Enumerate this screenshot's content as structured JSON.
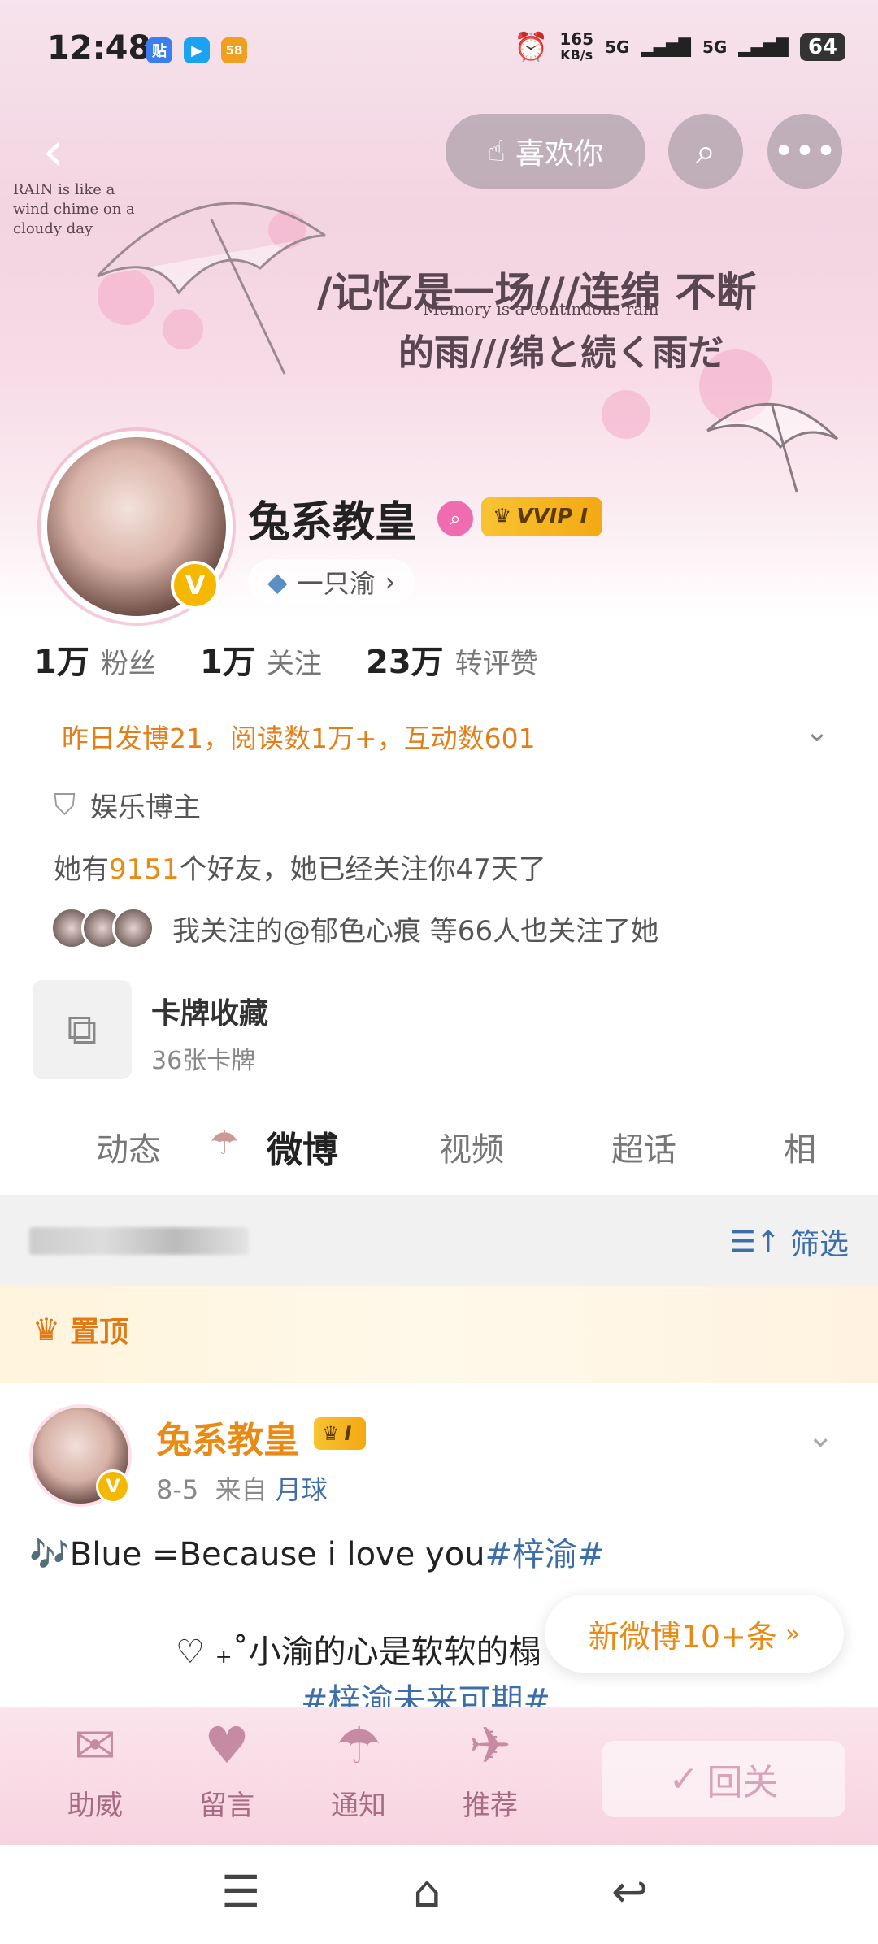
{
  "status_bar": {
    "time": "12:48",
    "app_badges": [
      "贴",
      "▶",
      "58"
    ],
    "net_speed": "165",
    "net_unit": "KB/s",
    "signal1": "5G",
    "signal2": "5G",
    "battery": "64"
  },
  "header": {
    "like_label": "喜欢你",
    "banner_title": "/记忆是一场///连绵 不断",
    "banner_title2": "的雨///绵と続く雨だ",
    "banner_en": "Memory is a continuous rain",
    "banner_small": "RAIN is like a wind chime on a cloudy day"
  },
  "profile": {
    "name": "兔系教皇",
    "vip_label": "VVIP I",
    "fan_group": "一只渝",
    "stats": [
      {
        "num": "1万",
        "label": "粉丝"
      },
      {
        "num": "1万",
        "label": "关注"
      },
      {
        "num": "23万",
        "label": "转评赞"
      }
    ],
    "summary": "昨日发博21，阅读数1万+，互动数601",
    "role": "娱乐博主",
    "friends_prefix": "她有",
    "friends_count": "9151",
    "friends_suffix": "个好友，她已经关注你47天了",
    "mutual": "我关注的@郁色心痕 等66人也关注了她",
    "cards_title": "卡牌收藏",
    "cards_sub": "36张卡牌"
  },
  "tabs": [
    "动态",
    "微博",
    "视频",
    "超话",
    "相"
  ],
  "filter": {
    "label": "筛选"
  },
  "pinned": {
    "label": "置顶"
  },
  "post": {
    "author": "兔系教皇",
    "badge": "I",
    "date": "8-5",
    "from": "来自",
    "source": "月球",
    "line1_text": "🎶Blue =Because i love you",
    "line1_topic": "#梓渝#",
    "line2": "♡ ₊˚小渝的心是软软的榻",
    "line3": "#梓渝未来可期#"
  },
  "new_posts": "新微博10+条",
  "actions": [
    "助威",
    "留言",
    "通知",
    "推荐"
  ],
  "follow_label": "回关"
}
